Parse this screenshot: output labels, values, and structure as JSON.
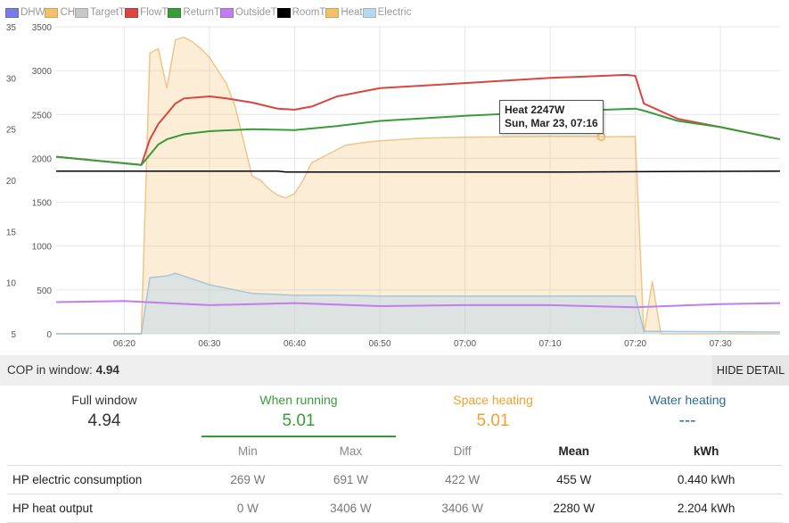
{
  "legend": [
    {
      "label": "DHW",
      "color": "#7b7be8"
    },
    {
      "label": "CH",
      "color": "#f3c06b"
    },
    {
      "label": "TargetT",
      "color": "#c8c8c8"
    },
    {
      "label": "FlowT",
      "color": "#d9453f"
    },
    {
      "label": "ReturnT",
      "color": "#3a9b3a"
    },
    {
      "label": "OutsideT",
      "color": "#c07ef0"
    },
    {
      "label": "RoomT",
      "color": "#000000"
    },
    {
      "label": "Heat",
      "color": "#f3c06b"
    },
    {
      "label": "Electric",
      "color": "#b7d8ef"
    }
  ],
  "tooltip": {
    "line1": "Heat 2247W",
    "line2": "Sun, Mar 23, 07:16"
  },
  "cop_bar": {
    "label": "COP in window:",
    "value": "4.94",
    "button": "HIDE DETAIL"
  },
  "stats": [
    {
      "label": "Full window",
      "value": "4.94",
      "color": "#333333"
    },
    {
      "label": "When running",
      "value": "5.01",
      "color": "#3a9b3a"
    },
    {
      "label": "Space heating",
      "value": "5.01",
      "color": "#f0a030"
    },
    {
      "label": "Water heating",
      "value": "---",
      "color": "#2f6b8c"
    }
  ],
  "table": {
    "headers": [
      "",
      "Min",
      "Max",
      "Diff",
      "Mean",
      "kWh"
    ],
    "rows": [
      {
        "name": "HP electric consumption",
        "min": "269 W",
        "max": "691 W",
        "diff": "422 W",
        "mean": "455 W",
        "kwh": "0.440 kWh"
      },
      {
        "name": "HP heat output",
        "min": "0 W",
        "max": "3406 W",
        "diff": "3406 W",
        "mean": "2280 W",
        "kwh": "2.204 kWh"
      }
    ]
  },
  "chart_data": {
    "type": "line",
    "x_ticks": [
      "06:20",
      "06:30",
      "06:40",
      "06:50",
      "07:00",
      "07:10",
      "07:20",
      "07:30"
    ],
    "x_range": [
      "06:12",
      "07:37"
    ],
    "y_left": {
      "ticks": [
        "5",
        "10",
        "15",
        "20",
        "25",
        "30",
        "35"
      ],
      "range": [
        5,
        35
      ]
    },
    "y_right": {
      "ticks": [
        "0",
        "500",
        "1000",
        "1500",
        "2000",
        "2500",
        "3000",
        "3500"
      ],
      "range": [
        0,
        3500
      ]
    },
    "grid": true,
    "series": [
      {
        "name": "Heat",
        "axis": "right",
        "type": "area",
        "x": [
          "06:12",
          "06:22",
          "06:23",
          "06:24",
          "06:25",
          "06:26",
          "06:27",
          "06:28",
          "06:29",
          "06:30",
          "06:31",
          "06:32",
          "06:33",
          "06:34",
          "06:35",
          "06:36",
          "06:37",
          "06:38",
          "06:39",
          "06:40",
          "06:41",
          "06:42",
          "06:43",
          "06:44",
          "06:45",
          "06:46",
          "06:48",
          "06:50",
          "06:55",
          "07:00",
          "07:05",
          "07:10",
          "07:15",
          "07:16",
          "07:20",
          "07:21",
          "07:22",
          "07:23",
          "07:24",
          "07:37"
        ],
        "y": [
          0,
          0,
          3200,
          3250,
          2800,
          3350,
          3380,
          3330,
          3250,
          3150,
          3000,
          2850,
          2600,
          2200,
          1800,
          1750,
          1650,
          1580,
          1550,
          1600,
          1750,
          1950,
          2000,
          2050,
          2100,
          2150,
          2180,
          2200,
          2230,
          2240,
          2245,
          2250,
          2250,
          2247,
          2250,
          0,
          600,
          0,
          0,
          0
        ]
      },
      {
        "name": "Electric",
        "axis": "right",
        "type": "area",
        "x": [
          "06:12",
          "06:22",
          "06:23",
          "06:25",
          "06:26",
          "06:30",
          "06:35",
          "06:40",
          "06:45",
          "06:50",
          "07:00",
          "07:10",
          "07:20",
          "07:21",
          "07:37"
        ],
        "y": [
          0,
          0,
          640,
          660,
          690,
          560,
          460,
          440,
          440,
          430,
          430,
          430,
          430,
          30,
          20
        ]
      },
      {
        "name": "FlowT",
        "axis": "left",
        "x": [
          "06:12",
          "06:22",
          "06:23",
          "06:24",
          "06:25",
          "06:26",
          "06:27",
          "06:30",
          "06:32",
          "06:35",
          "06:38",
          "06:40",
          "06:42",
          "06:45",
          "06:50",
          "07:00",
          "07:10",
          "07:19",
          "07:20",
          "07:21",
          "07:25",
          "07:30",
          "07:37"
        ],
        "y": [
          22.3,
          21.5,
          24,
          25.5,
          26.5,
          27.5,
          28,
          28.2,
          28,
          27.6,
          27,
          26.9,
          27.2,
          28.2,
          29,
          29.5,
          30,
          30.3,
          30.2,
          27.5,
          26,
          25.2,
          24
        ]
      },
      {
        "name": "ReturnT",
        "axis": "left",
        "x": [
          "06:12",
          "06:22",
          "06:23",
          "06:24",
          "06:25",
          "06:27",
          "06:30",
          "06:35",
          "06:40",
          "06:45",
          "06:50",
          "07:00",
          "07:10",
          "07:20",
          "07:21",
          "07:25",
          "07:30",
          "07:37"
        ],
        "y": [
          22.3,
          21.5,
          22.5,
          23.5,
          24,
          24.5,
          24.8,
          25,
          24.9,
          25.3,
          25.8,
          26.3,
          26.7,
          27,
          26.8,
          25.8,
          25.2,
          24
        ]
      },
      {
        "name": "RoomT",
        "axis": "left",
        "x": [
          "06:12",
          "06:38",
          "06:39",
          "07:10",
          "07:37"
        ],
        "y": [
          20.9,
          20.9,
          20.8,
          20.8,
          20.9
        ]
      },
      {
        "name": "OutsideT",
        "axis": "left",
        "x": [
          "06:12",
          "06:20",
          "06:25",
          "06:30",
          "06:40",
          "06:50",
          "07:00",
          "07:10",
          "07:20",
          "07:30",
          "07:37"
        ],
        "y": [
          8.1,
          8.2,
          8.0,
          7.8,
          8.0,
          7.7,
          7.8,
          7.8,
          7.6,
          7.9,
          8.0
        ]
      }
    ]
  }
}
